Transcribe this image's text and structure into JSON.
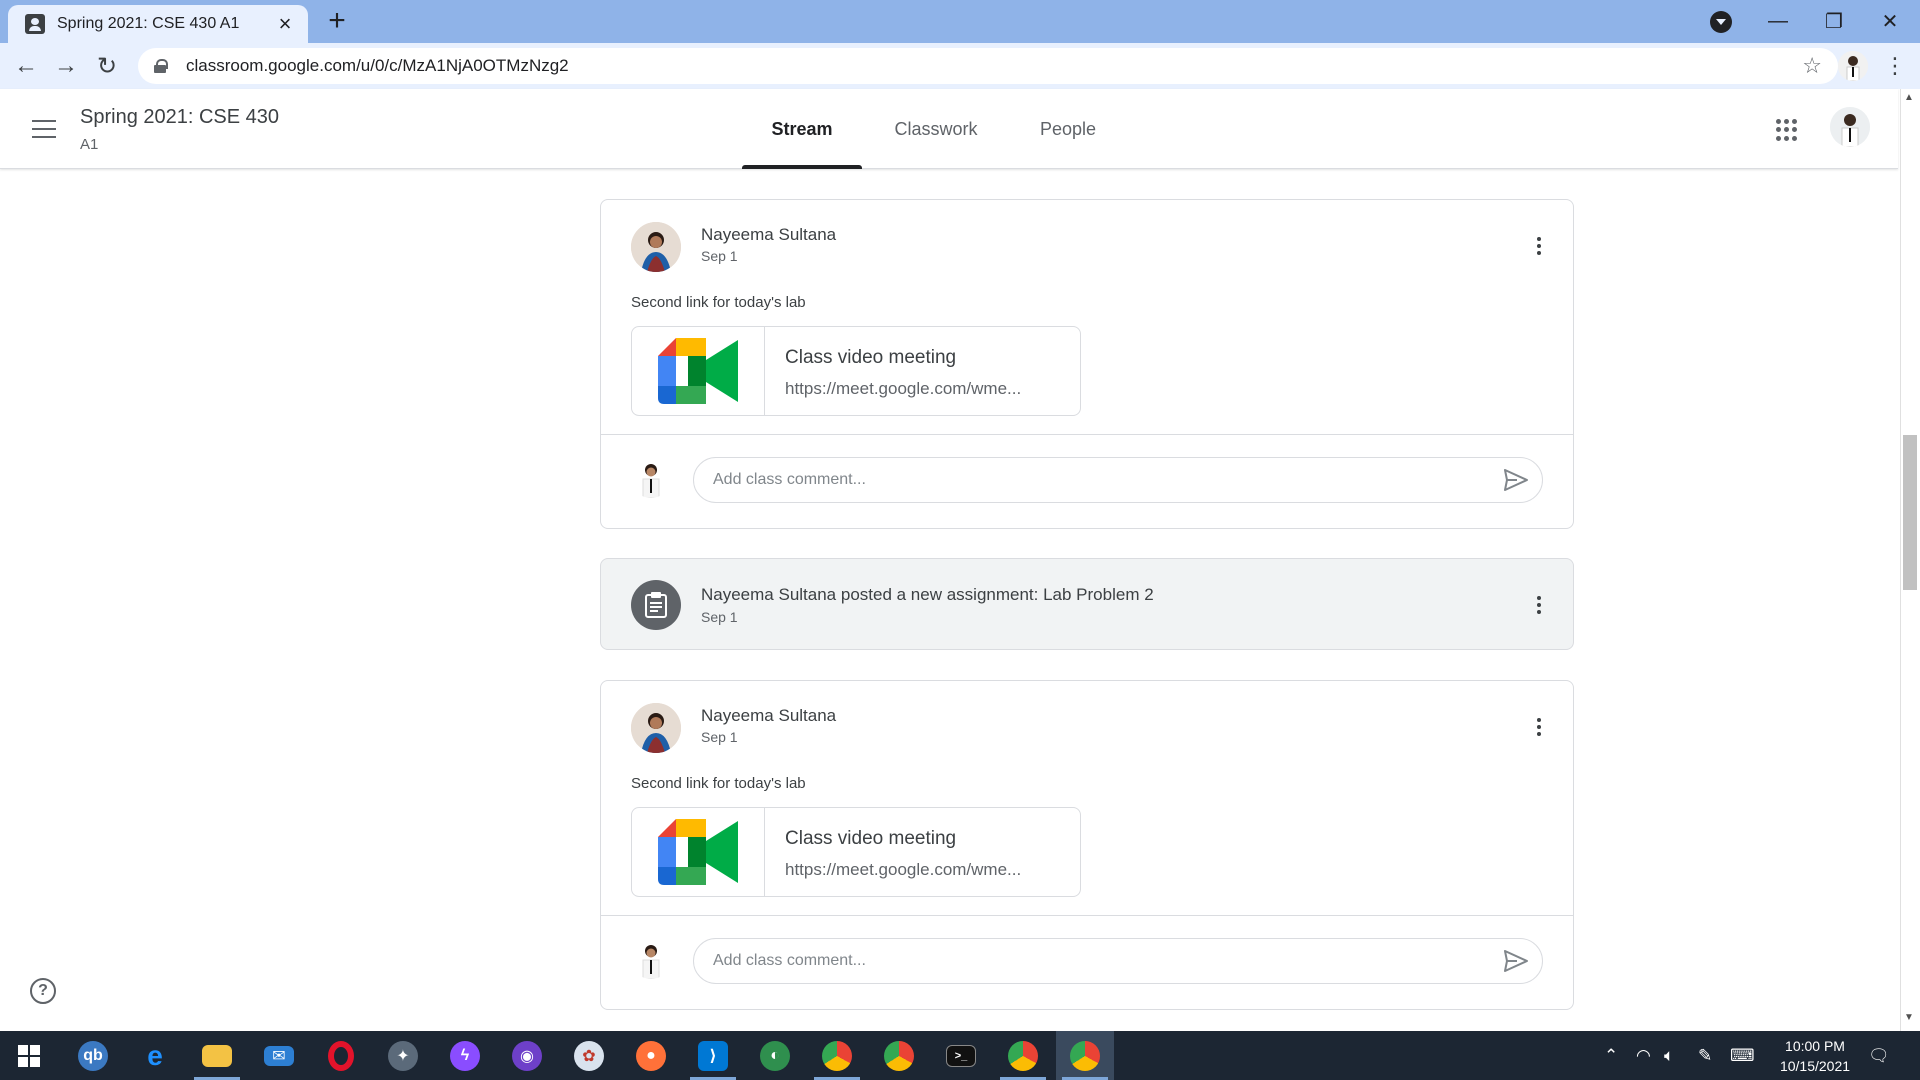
{
  "browser": {
    "tab_title": "Spring 2021: CSE 430 A1",
    "url": "classroom.google.com/u/0/c/MzA1NjA0OTMzNzg2"
  },
  "header": {
    "class_title": "Spring 2021: CSE 430",
    "class_section": "A1",
    "tabs": [
      {
        "label": "Stream",
        "active": true
      },
      {
        "label": "Classwork",
        "active": false
      },
      {
        "label": "People",
        "active": false
      }
    ]
  },
  "stream": {
    "posts": [
      {
        "author": "Nayeema Sultana",
        "date": "Sep 1",
        "text": "Second link for today's lab",
        "attachment": {
          "title": "Class video meeting",
          "url": "https://meet.google.com/wme..."
        },
        "comment_placeholder": "Add class comment..."
      },
      {
        "author": "Nayeema Sultana",
        "date": "Sep 1",
        "text": "Second link for today's lab",
        "attachment": {
          "title": "Class video meeting",
          "url": "https://meet.google.com/wme..."
        },
        "comment_placeholder": "Add class comment..."
      }
    ],
    "assignment": {
      "title": "Nayeema Sultana posted a new assignment: Lab Problem 2",
      "date": "Sep 1"
    }
  },
  "help_icon": "help-icon",
  "taskbar": {
    "apps": [
      "windows-start",
      "qbittorrent",
      "edge",
      "file-explorer",
      "mail",
      "opera",
      "satellite-app",
      "messenger",
      "github-desktop",
      "paint-app",
      "firefox",
      "vscode",
      "photo-app",
      "chrome-profile",
      "chrome",
      "terminal",
      "chrome-ek",
      "chrome-active"
    ],
    "time": "10:00 PM",
    "date": "10/15/2021"
  },
  "colors": {
    "tabstrip": "#8fb3e8",
    "toolbar": "#e8f0fe",
    "active_tab_underline": "#202124",
    "assignment_bg": "#f1f3f4",
    "taskbar": "#1c2633"
  }
}
